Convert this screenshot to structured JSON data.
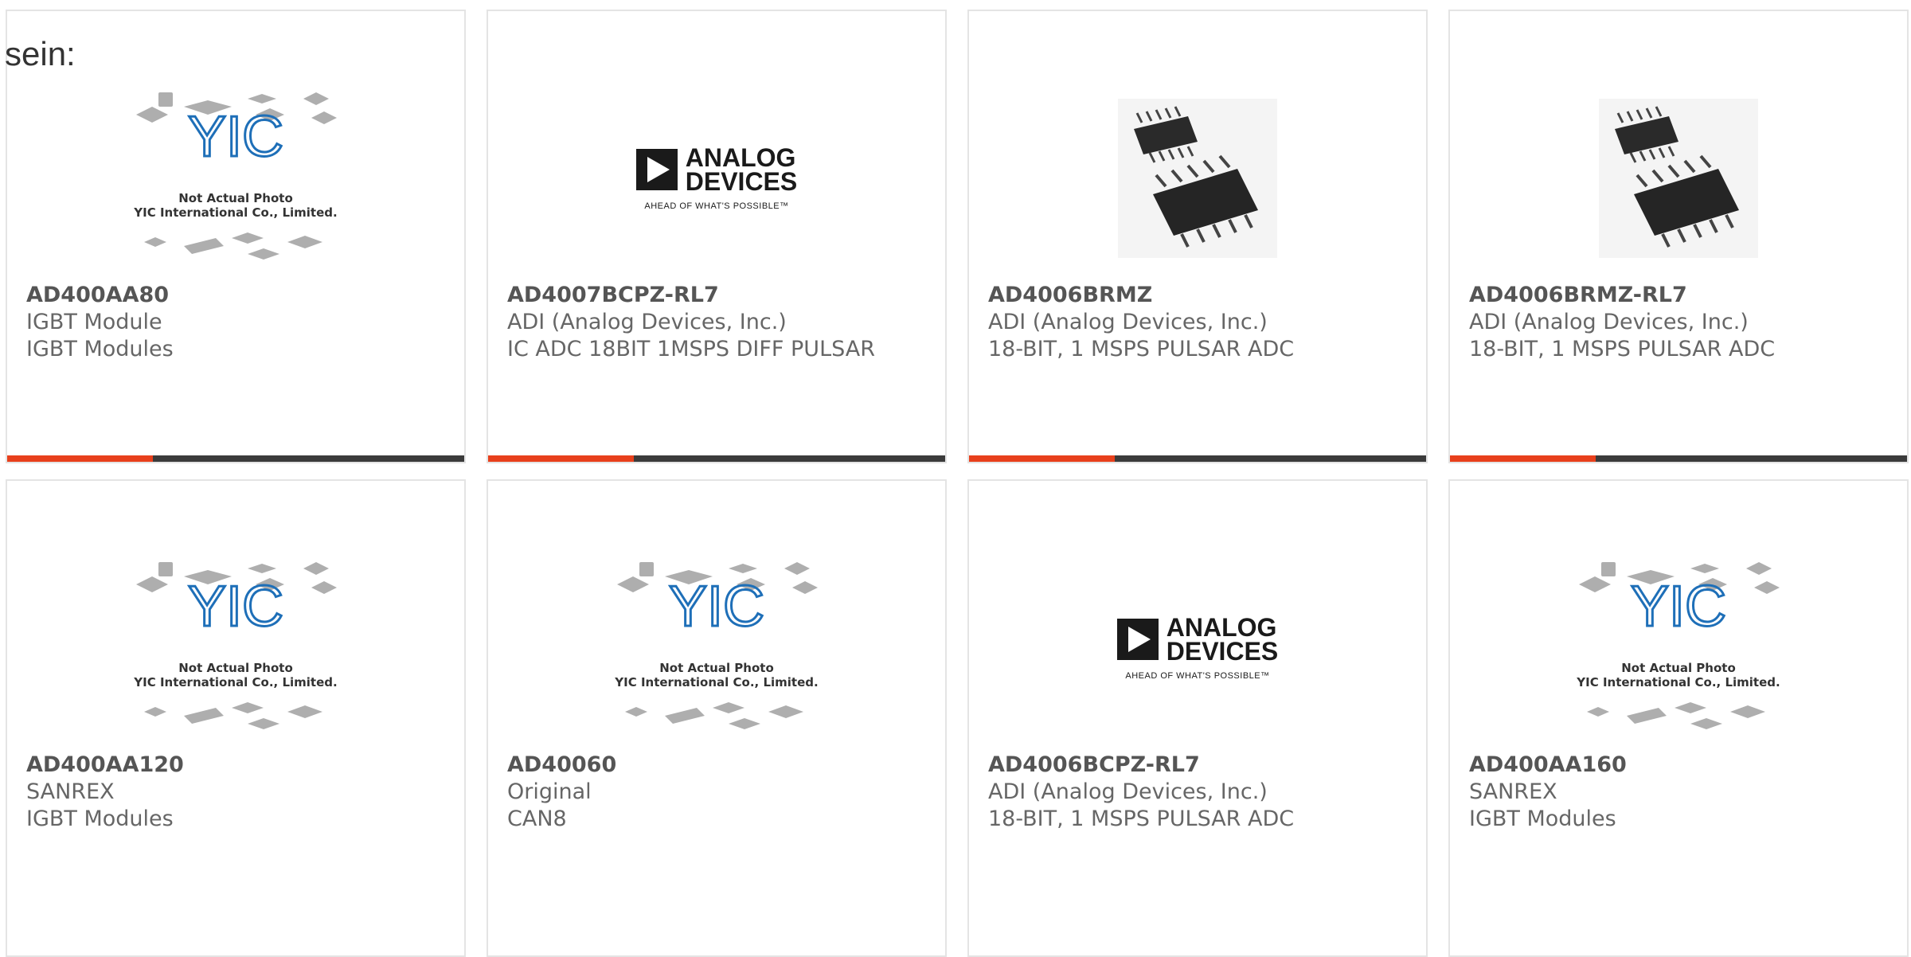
{
  "lead_text": "sein:",
  "colors": {
    "accent": "#e8401c",
    "bar": "#3b3b3b",
    "border": "#e4e4e4",
    "text": "#666666"
  },
  "placeholder": {
    "line1": "Not Actual Photo",
    "line2": "YIC International Co., Limited.",
    "logo": "YIC"
  },
  "adi_logo": {
    "line1": "ANALOG",
    "line2": "DEVICES",
    "tagline": "AHEAD OF WHAT'S POSSIBLE™"
  },
  "products": [
    {
      "part": "AD400AA80",
      "brand": "IGBT Module",
      "desc": "IGBT Modules",
      "image": "placeholder"
    },
    {
      "part": "AD4007BCPZ-RL7",
      "brand": "ADI (Analog Devices, Inc.)",
      "desc": "IC ADC 18BIT 1MSPS DIFF PULSAR",
      "image": "adi-logo"
    },
    {
      "part": "AD4006BRMZ",
      "brand": "ADI (Analog Devices, Inc.)",
      "desc": "18-BIT, 1 MSPS PULSAR ADC",
      "image": "chip-photo"
    },
    {
      "part": "AD4006BRMZ-RL7",
      "brand": "ADI (Analog Devices, Inc.)",
      "desc": "18-BIT, 1 MSPS PULSAR ADC",
      "image": "chip-photo"
    },
    {
      "part": "AD400AA120",
      "brand": "SANREX",
      "desc": "IGBT Modules",
      "image": "placeholder"
    },
    {
      "part": "AD40060",
      "brand": "Original",
      "desc": "CAN8",
      "image": "placeholder"
    },
    {
      "part": "AD4006BCPZ-RL7",
      "brand": "ADI (Analog Devices, Inc.)",
      "desc": "18-BIT, 1 MSPS PULSAR ADC",
      "image": "adi-logo"
    },
    {
      "part": "AD400AA160",
      "brand": "SANREX",
      "desc": "IGBT Modules",
      "image": "placeholder"
    }
  ]
}
